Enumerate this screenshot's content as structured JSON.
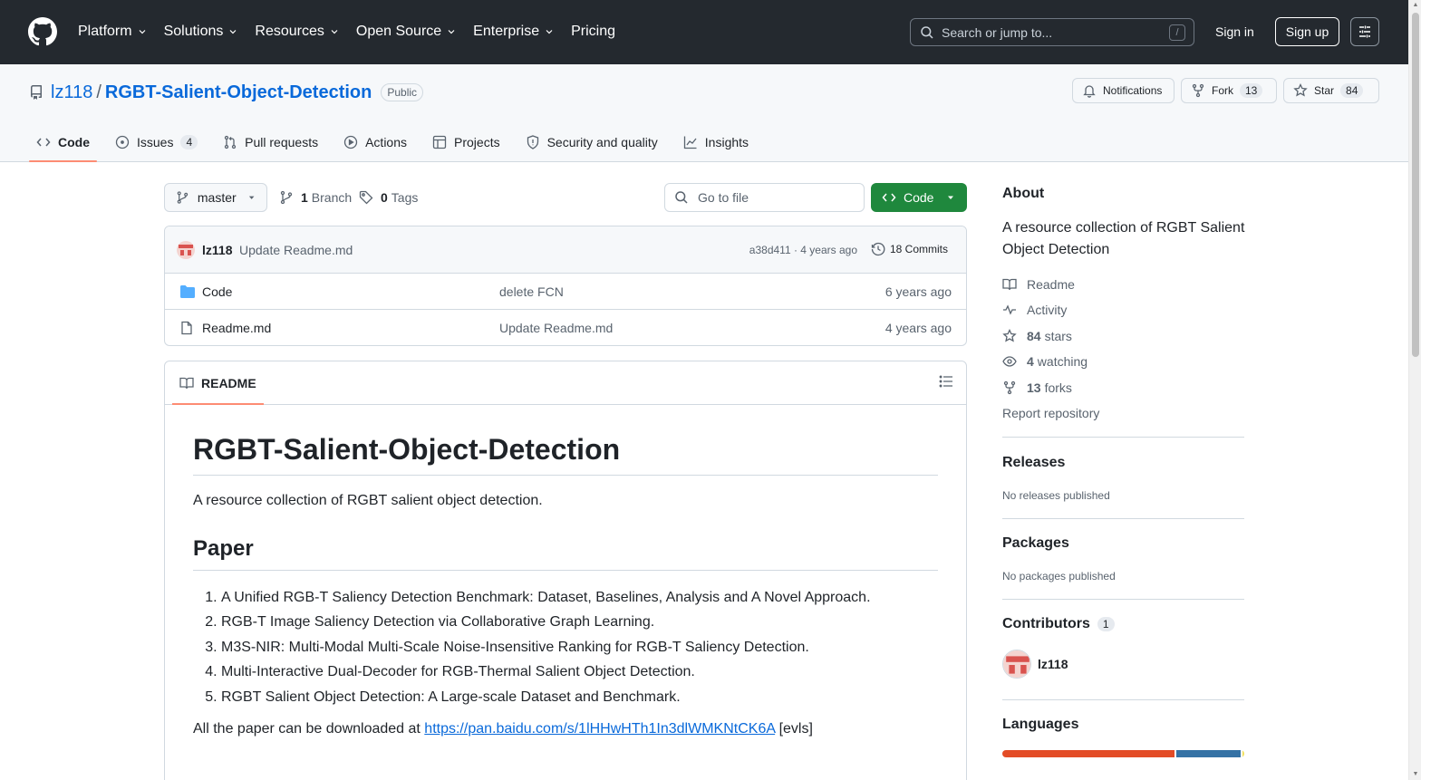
{
  "header": {
    "nav": [
      "Platform",
      "Solutions",
      "Resources",
      "Open Source",
      "Enterprise",
      "Pricing"
    ],
    "search_placeholder": "Search or jump to...",
    "search_key": "/",
    "sign_in": "Sign in",
    "sign_up": "Sign up"
  },
  "repo": {
    "owner": "lz118",
    "separator": "/",
    "name": "RGBT-Salient-Object-Detection",
    "visibility": "Public",
    "notifications_label": "Notifications",
    "fork_label": "Fork",
    "fork_count": "13",
    "star_label": "Star",
    "star_count": "84"
  },
  "tabs": [
    {
      "label": "Code",
      "count": ""
    },
    {
      "label": "Issues",
      "count": "4"
    },
    {
      "label": "Pull requests",
      "count": ""
    },
    {
      "label": "Actions",
      "count": ""
    },
    {
      "label": "Projects",
      "count": ""
    },
    {
      "label": "Security and quality",
      "count": ""
    },
    {
      "label": "Insights",
      "count": ""
    }
  ],
  "filenav": {
    "branch": "master",
    "branch_count": "1",
    "branch_label": "Branch",
    "tag_count": "0",
    "tag_label": "Tags",
    "goto_placeholder": "Go to file",
    "code_button": "Code"
  },
  "commit": {
    "author": "lz118",
    "message": "Update Readme.md",
    "hash_age": "a38d411 · 4 years ago",
    "commits": "18 Commits"
  },
  "files": [
    {
      "name": "Code",
      "type": "folder",
      "message": "delete FCN",
      "age": "6 years ago"
    },
    {
      "name": "Readme.md",
      "type": "file",
      "message": "Update Readme.md",
      "age": "4 years ago"
    }
  ],
  "readme": {
    "tab_label": "README",
    "title": "RGBT-Salient-Object-Detection",
    "intro": "A resource collection of RGBT salient object detection.",
    "section": "Paper",
    "papers": [
      "A Unified RGB-T Saliency Detection Benchmark: Dataset, Baselines, Analysis and A Novel Approach.",
      "RGB-T Image Saliency Detection via Collaborative Graph Learning.",
      "M3S-NIR: Multi-Modal Multi-Scale Noise-Insensitive Ranking for RGB-T Saliency Detection.",
      "Multi-Interactive Dual-Decoder for RGB-Thermal Salient Object Detection.",
      "RGBT Salient Object Detection: A Large-scale Dataset and Benchmark."
    ],
    "download_prefix": "All the paper can be downloaded at ",
    "download_link": "https://pan.baidu.com/s/1lHHwHTh1In3dlWMKNtCK6A",
    "download_suffix": " [evls]"
  },
  "sidebar": {
    "about_title": "About",
    "about_desc": "A resource collection of RGBT Salient Object Detection",
    "readme": "Readme",
    "activity": "Activity",
    "stars_count": "84",
    "stars_label": "stars",
    "watching_count": "4",
    "watching_label": "watching",
    "forks_count": "13",
    "forks_label": "forks",
    "report": "Report repository",
    "releases_title": "Releases",
    "releases_none": "No releases published",
    "packages_title": "Packages",
    "packages_none": "No packages published",
    "contributors_title": "Contributors",
    "contributors_count": "1",
    "contributor": "lz118",
    "languages_title": "Languages",
    "language_colors": [
      "#e34c26",
      "#3572A5",
      "#f1e05a"
    ]
  },
  "colors": {
    "header_bg": "#24292f",
    "accent_link": "#0969da",
    "primary_button": "#1f883d",
    "tab_underline": "#fd8c73"
  }
}
